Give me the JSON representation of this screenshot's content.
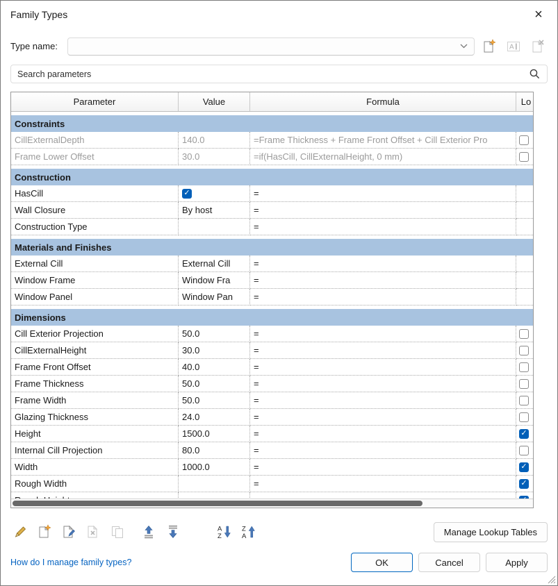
{
  "window": {
    "title": "Family Types",
    "close_glyph": "×"
  },
  "type_name": {
    "label": "Type name:",
    "value": ""
  },
  "search": {
    "placeholder": "Search parameters"
  },
  "table": {
    "columns": [
      "Parameter",
      "Value",
      "Formula",
      "Lo"
    ],
    "sections": [
      {
        "title": "Constraints",
        "rows": [
          {
            "parameter": "CillExternalDepth",
            "value": "140.0",
            "formula": "=Frame Thickness + Frame Front Offset + Cill Exterior Pro",
            "lock": "unchecked",
            "disabled": true
          },
          {
            "parameter": "Frame Lower Offset",
            "value": "30.0",
            "formula": "=if(HasCill, CillExternalHeight, 0 mm)",
            "lock": "unchecked",
            "disabled": true
          }
        ]
      },
      {
        "title": "Construction",
        "rows": [
          {
            "parameter": "HasCill",
            "value": "",
            "value_checkbox": true,
            "value_checked": true,
            "formula": "=",
            "lock": "none"
          },
          {
            "parameter": "Wall Closure",
            "value": "By host",
            "formula": "=",
            "lock": "none"
          },
          {
            "parameter": "Construction Type",
            "value": "",
            "formula": "=",
            "lock": "none"
          }
        ]
      },
      {
        "title": "Materials and Finishes",
        "rows": [
          {
            "parameter": "External Cill",
            "value": "External Cill",
            "formula": "=",
            "lock": "none"
          },
          {
            "parameter": "Window Frame",
            "value": "Window Fra",
            "formula": "=",
            "lock": "none"
          },
          {
            "parameter": "Window Panel",
            "value": "Window Pan",
            "formula": "=",
            "lock": "none"
          }
        ]
      },
      {
        "title": "Dimensions",
        "rows": [
          {
            "parameter": "Cill Exterior Projection",
            "value": "50.0",
            "formula": "=",
            "lock": "unchecked"
          },
          {
            "parameter": "CillExternalHeight",
            "value": "30.0",
            "formula": "=",
            "lock": "unchecked"
          },
          {
            "parameter": "Frame Front Offset",
            "value": "40.0",
            "formula": "=",
            "lock": "unchecked"
          },
          {
            "parameter": "Frame Thickness",
            "value": "50.0",
            "formula": "=",
            "lock": "unchecked"
          },
          {
            "parameter": "Frame Width",
            "value": "50.0",
            "formula": "=",
            "lock": "unchecked"
          },
          {
            "parameter": "Glazing Thickness",
            "value": "24.0",
            "formula": "=",
            "lock": "unchecked"
          },
          {
            "parameter": "Height",
            "value": "1500.0",
            "formula": "=",
            "lock": "checked"
          },
          {
            "parameter": "Internal Cill Projection",
            "value": "80.0",
            "formula": "=",
            "lock": "unchecked"
          },
          {
            "parameter": "Width",
            "value": "1000.0",
            "formula": "=",
            "lock": "checked"
          },
          {
            "parameter": "Rough Width",
            "value": "",
            "formula": "=",
            "lock": "checked"
          },
          {
            "parameter": "Rough Height",
            "value": "",
            "formula": "",
            "lock": "checked",
            "clipped": true
          }
        ]
      }
    ]
  },
  "toolbar": {
    "manage_lookup_label": "Manage Lookup Tables"
  },
  "footer": {
    "help_link": "How do I manage family types?",
    "ok_label": "OK",
    "cancel_label": "Cancel",
    "apply_label": "Apply"
  }
}
